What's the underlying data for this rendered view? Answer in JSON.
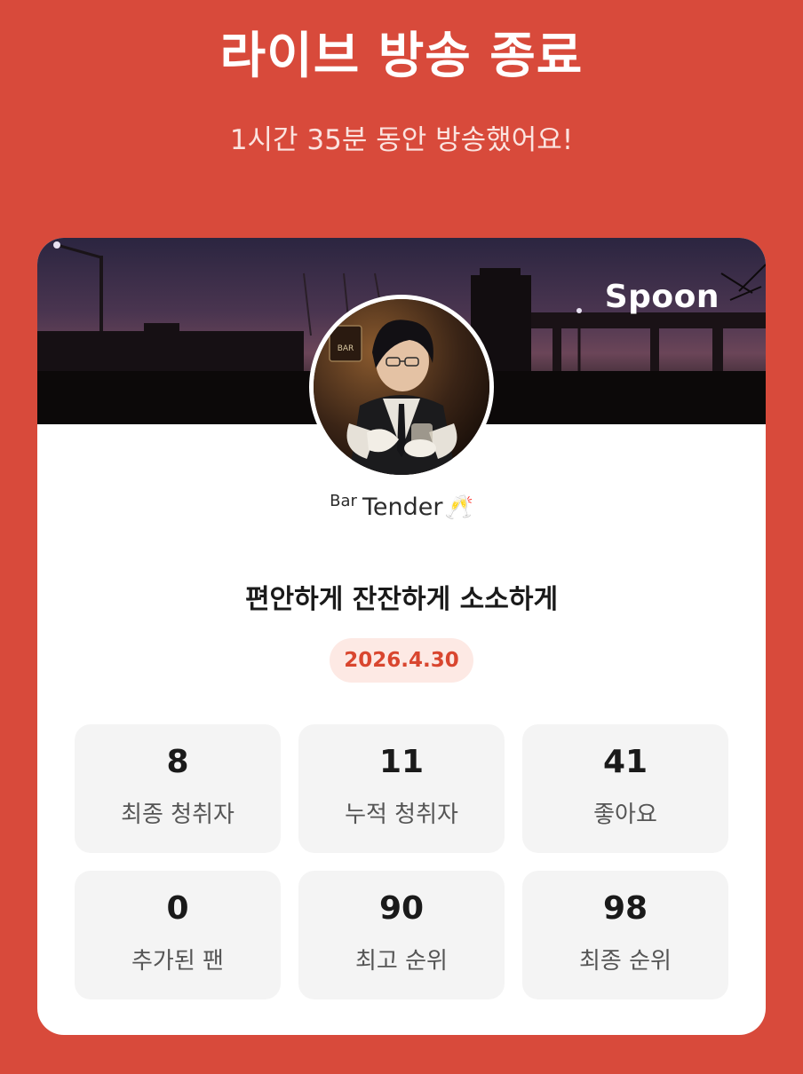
{
  "header": {
    "title": "라이브 방송 종료",
    "subtitle": "1시간 35분 동안 방송했어요!"
  },
  "card": {
    "brand": "Spoon",
    "avatar_icon": "dj-profile-avatar",
    "user": {
      "name_prefix": "Bar",
      "name_main": "Tender",
      "name_emoji": "🥂"
    },
    "broadcast_title": "편안하게 잔잔하게 소소하게",
    "date": "2026.4.30",
    "colors": {
      "background": "#d84a3b",
      "badge_bg": "#fde9e4",
      "badge_text": "#d9462f"
    },
    "stats": [
      {
        "value": "8",
        "label": "최종 청취자"
      },
      {
        "value": "11",
        "label": "누적 청취자"
      },
      {
        "value": "41",
        "label": "좋아요"
      },
      {
        "value": "0",
        "label": "추가된 팬"
      },
      {
        "value": "90",
        "label": "최고 순위"
      },
      {
        "value": "98",
        "label": "최종 순위"
      }
    ]
  }
}
